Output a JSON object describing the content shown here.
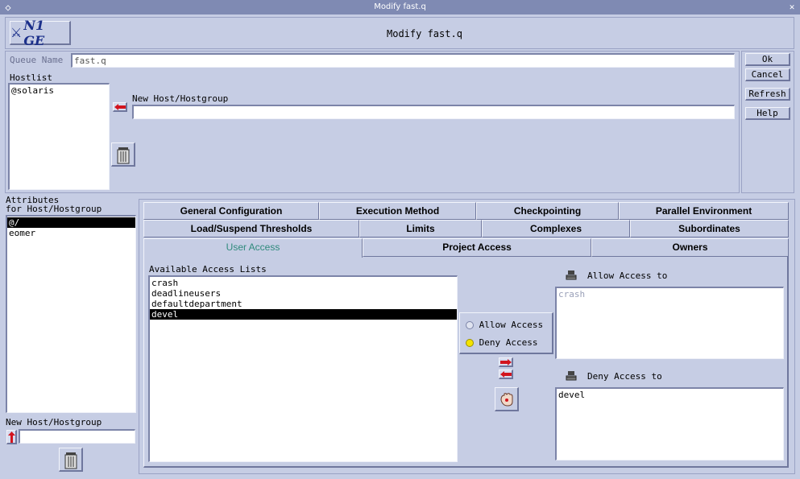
{
  "window": {
    "title": "Modify fast.q"
  },
  "header": {
    "logo_text": "N1 GE",
    "title": "Modify fast.q"
  },
  "queue_name": {
    "label": "Queue Name",
    "value": "fast.q"
  },
  "hostlist": {
    "label": "Hostlist",
    "items": [
      "@solaris"
    ]
  },
  "new_host": {
    "label": "New Host/Hostgroup",
    "value": ""
  },
  "side_buttons": {
    "ok": "Ok",
    "cancel": "Cancel",
    "refresh": "Refresh",
    "help": "Help"
  },
  "attributes": {
    "label_line1": "Attributes",
    "label_line2": "for Host/Hostgroup",
    "items": [
      "@/",
      "eomer"
    ],
    "selected_index": 0,
    "new_host_label": "New Host/Hostgroup",
    "new_host_value": ""
  },
  "tabs": {
    "row1": [
      "General Configuration",
      "Execution Method",
      "Checkpointing",
      "Parallel Environment"
    ],
    "row2": [
      "Load/Suspend Thresholds",
      "Limits",
      "Complexes",
      "Subordinates"
    ],
    "row3": [
      "User Access",
      "Project Access",
      "Owners"
    ],
    "active": "User Access"
  },
  "access": {
    "available_label": "Available Access Lists",
    "available_items": [
      "crash",
      "deadlineusers",
      "defaultdepartment",
      "devel"
    ],
    "selected_index": 3,
    "allow_radio": "Allow Access",
    "deny_radio": "Deny Access",
    "selected_radio": "deny",
    "allow_label": "Allow Access to",
    "allow_items": [
      "crash"
    ],
    "deny_label": "Deny Access to",
    "deny_items": [
      "devel"
    ]
  },
  "colors": {
    "background": "#c6cde4",
    "titlebar": "#7f8ab3",
    "active_tab_text": "#2f8a7c",
    "selection": "#000000",
    "radio_on": "#f4e300"
  }
}
